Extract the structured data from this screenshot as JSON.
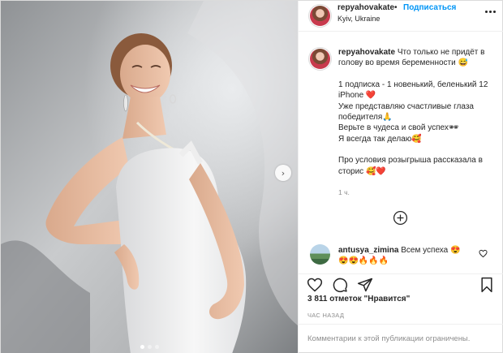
{
  "header": {
    "username": "repyahovakate",
    "separator": "•",
    "follow_label": "Подписаться",
    "location": "Kyiv, Ukraine",
    "more_icon": "more-horizontal-icon"
  },
  "caption": {
    "username": "repyahovakate",
    "lines": [
      "Что только не придёт в голову во время беременности 😅",
      "",
      "1 подписка - 1 новенький, беленький 12 iPhone ❤️",
      "Уже представляю счастливые глаза победителя🙏",
      "Верьте в чудеса и свой успех🕶",
      "Я всегда так делаю🥰",
      "",
      "Про условия розыгрыша рассказала в сторис 🥰❤️"
    ],
    "time": "1 ч.",
    "load_more_icon": "plus-circle-icon"
  },
  "comment": {
    "username": "antusya_zimina",
    "text": "Всем успеха 😍",
    "emojis": "😍😍🔥🔥🔥",
    "like_icon": "heart-outline-icon"
  },
  "actions": {
    "icons": [
      "heart-outline-icon",
      "comment-bubble-icon",
      "share-paper-plane-icon",
      "bookmark-icon"
    ]
  },
  "likes": {
    "count": "3 811 отметок",
    "label": "\"Нравится\""
  },
  "time_ago": "ЧАС НАЗАД",
  "comments_restricted": "Комментарии к этой публикации ограничены.",
  "media": {
    "slides": 3,
    "active_slide": 1,
    "next_icon": "chevron-right-icon"
  },
  "colors": {
    "accent": "#0095f6",
    "text": "#262626",
    "muted": "#8e8e8e",
    "border": "#dbdbdb",
    "like_red": "#ed4956"
  }
}
